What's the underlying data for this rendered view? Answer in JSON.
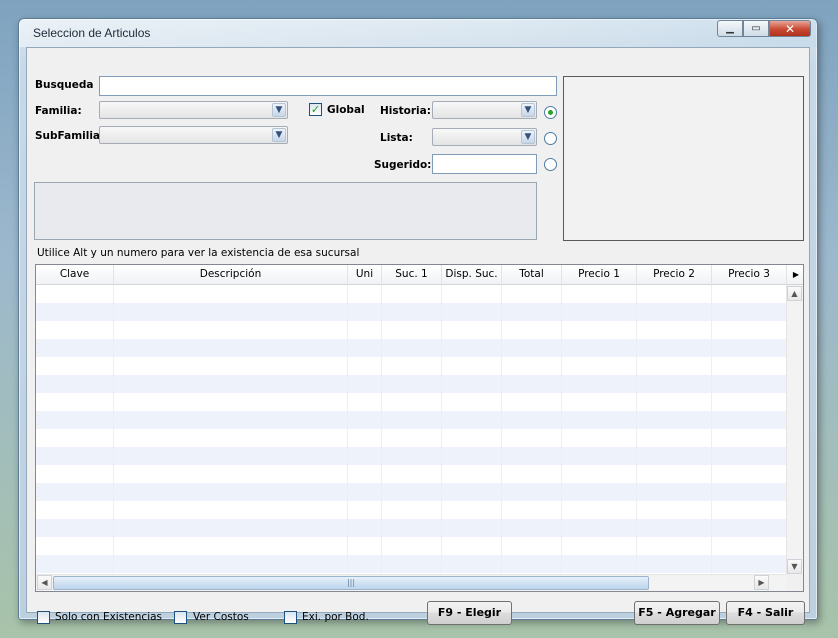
{
  "window": {
    "title": "Seleccion de Articulos",
    "min_icon": "minimize-icon",
    "max_icon": "maximize-icon",
    "close_icon": "close-icon"
  },
  "search": {
    "label": "Busqueda",
    "value": ""
  },
  "familia": {
    "label": "Familia:",
    "value": ""
  },
  "subfamilia": {
    "label": "SubFamilia:",
    "value": ""
  },
  "global": {
    "label": "Global",
    "checked": true
  },
  "historia": {
    "label": "Historia:",
    "value": "",
    "selected": true
  },
  "lista": {
    "label": "Lista:",
    "value": "",
    "selected": false
  },
  "sugerido": {
    "label": "Sugerido:",
    "value": "",
    "selected": false
  },
  "hint": "Utilice Alt y un numero para ver la existencia de esa sucursal",
  "grid": {
    "columns": [
      "Clave",
      "Descripción",
      "Uni",
      "Suc. 1",
      "Disp. Suc.",
      "Total",
      "Precio 1",
      "Precio 2",
      "Precio 3"
    ],
    "rows": []
  },
  "options": {
    "solo_existencias": "Solo con Existencias",
    "ver_costos": "Ver Costos",
    "exi_bod": "Exi. por Bod."
  },
  "buttons": {
    "elegir": "F9 - Elegir",
    "agregar": "F5 - Agregar",
    "salir": "F4 - Salir"
  },
  "colors": {
    "accent": "#27a727",
    "title_bar": "#c7d8e6",
    "close": "#c94a33"
  }
}
